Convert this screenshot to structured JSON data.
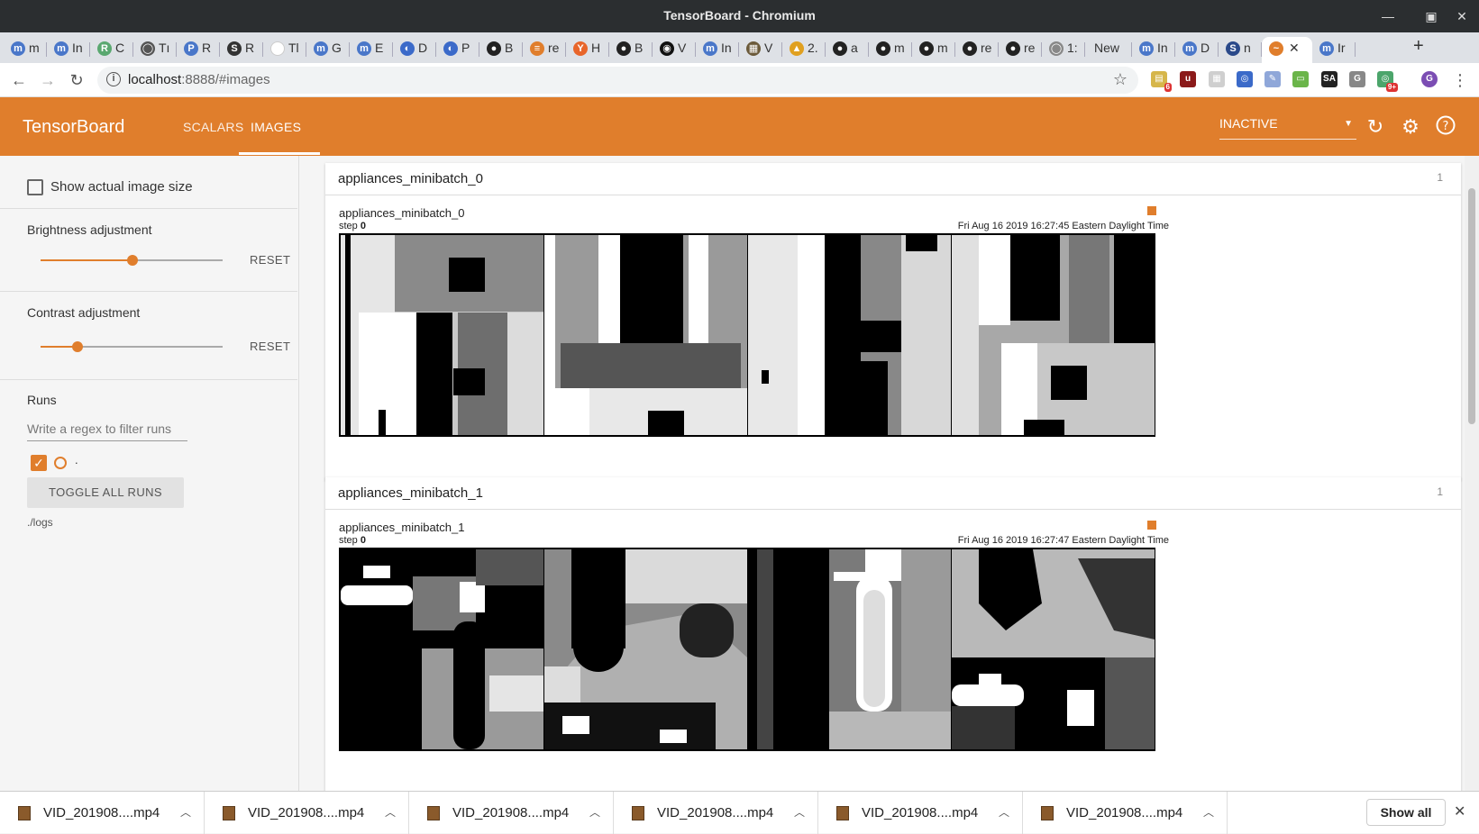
{
  "window": {
    "title": "TensorBoard - Chromium"
  },
  "tabs": [
    {
      "icon": "m",
      "label": "m",
      "color": "#4a77c9"
    },
    {
      "icon": "m",
      "label": "In",
      "color": "#4a77c9"
    },
    {
      "icon": "R",
      "label": "C",
      "color": "#5aa870"
    },
    {
      "icon": "◯",
      "label": "Tı",
      "color": "#555555"
    },
    {
      "icon": "P",
      "label": "R",
      "color": "#4a77c9"
    },
    {
      "icon": "S",
      "label": "R",
      "color": "#333333"
    },
    {
      "icon": " ",
      "label": "Tl",
      "color": "#ffffff"
    },
    {
      "icon": "m",
      "label": "G",
      "color": "#4a77c9"
    },
    {
      "icon": "m",
      "label": "E",
      "color": "#4a77c9"
    },
    {
      "icon": "◐",
      "label": "D",
      "color": "#3b6ac9"
    },
    {
      "icon": "◐",
      "label": "P",
      "color": "#3b6ac9"
    },
    {
      "icon": "●",
      "label": "B",
      "color": "#222222"
    },
    {
      "icon": "≡",
      "label": "re",
      "color": "#e07e2c"
    },
    {
      "icon": "Y",
      "label": "H",
      "color": "#e8652a"
    },
    {
      "icon": "●",
      "label": "B",
      "color": "#222222"
    },
    {
      "icon": "◉",
      "label": "V",
      "color": "#111111"
    },
    {
      "icon": "m",
      "label": "In",
      "color": "#4a77c9"
    },
    {
      "icon": "▦",
      "label": "V",
      "color": "#6b5a3a"
    },
    {
      "icon": "▲",
      "label": "2.",
      "color": "#e0a020"
    },
    {
      "icon": "●",
      "label": "a",
      "color": "#222222"
    },
    {
      "icon": "●",
      "label": "m",
      "color": "#222222"
    },
    {
      "icon": "●",
      "label": "m",
      "color": "#222222"
    },
    {
      "icon": "●",
      "label": "re",
      "color": "#222222"
    },
    {
      "icon": "●",
      "label": "re",
      "color": "#222222"
    },
    {
      "icon": "◯",
      "label": "1:",
      "color": "#888888"
    },
    {
      "icon": "",
      "label": "New",
      "color": "#ffffff"
    },
    {
      "icon": "m",
      "label": "In",
      "color": "#4a77c9"
    },
    {
      "icon": "m",
      "label": "D",
      "color": "#4a77c9"
    },
    {
      "icon": "S",
      "label": "n",
      "color": "#2b4a8a"
    },
    {
      "icon": "~",
      "label": "",
      "color": "#e07e2c",
      "active": true
    },
    {
      "icon": "m",
      "label": "Ir",
      "color": "#4a77c9"
    }
  ],
  "address": {
    "host": "localhost",
    "rest": ":8888/#images"
  },
  "tensorboard": {
    "brand": "TensorBoard",
    "nav": [
      {
        "label": "SCALARS"
      },
      {
        "label": "IMAGES",
        "active": true
      }
    ],
    "status_select": "INACTIVE"
  },
  "sidebar": {
    "show_actual_size": "Show actual image size",
    "brightness": {
      "label": "Brightness adjustment",
      "reset": "RESET",
      "value": 0.5
    },
    "contrast": {
      "label": "Contrast adjustment",
      "reset": "RESET",
      "value": 0.2
    },
    "runs": {
      "title": "Runs",
      "filter_placeholder": "Write a regex to filter runs",
      "run_name": ".",
      "toggle_all": "TOGGLE ALL RUNS",
      "logdir": "./logs"
    }
  },
  "cards": [
    {
      "name": "appliances_minibatch_0",
      "count": "1",
      "image_title": "appliances_minibatch_0",
      "step_label": "step",
      "step_value": "0",
      "timestamp": "Fri Aug 16 2019 16:27:45 Eastern Daylight Time"
    },
    {
      "name": "appliances_minibatch_1",
      "count": "1",
      "image_title": "appliances_minibatch_1",
      "step_label": "step",
      "step_value": "0",
      "timestamp": "Fri Aug 16 2019 16:27:47 Eastern Daylight Time"
    }
  ],
  "downloads": {
    "items": [
      "VID_201908....mp4",
      "VID_201908....mp4",
      "VID_201908....mp4",
      "VID_201908....mp4",
      "VID_201908....mp4",
      "VID_201908....mp4"
    ],
    "show_all": "Show all"
  }
}
